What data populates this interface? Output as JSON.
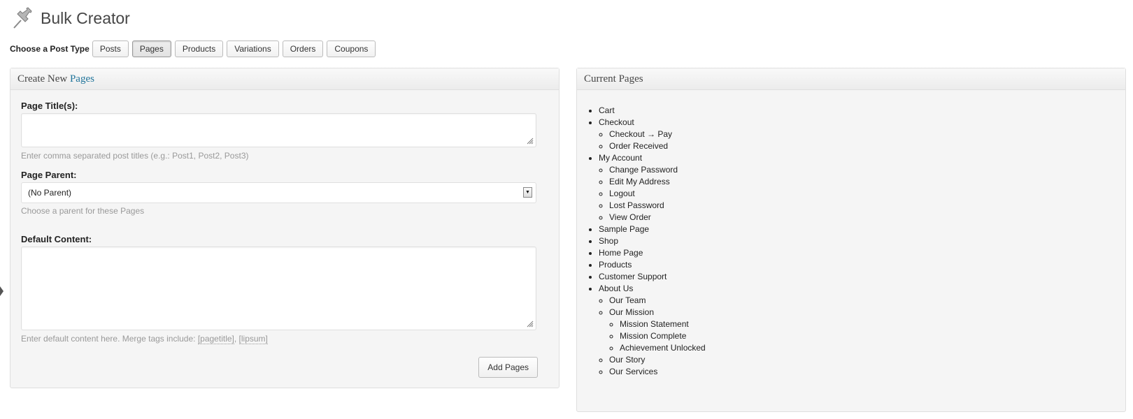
{
  "header": {
    "title": "Bulk Creator",
    "icon": "pushpin-icon"
  },
  "post_type": {
    "label": "Choose a Post Type",
    "options": [
      "Posts",
      "Pages",
      "Products",
      "Variations",
      "Orders",
      "Coupons"
    ],
    "selected": "Pages"
  },
  "create_panel": {
    "title_prefix": "Create New",
    "title_accent": "Pages",
    "page_title_label": "Page Title(s):",
    "page_title_value": "",
    "page_title_hint": "Enter comma separated post titles (e.g.: Post1, Post2, Post3)",
    "parent_label": "Page Parent:",
    "parent_value": "(No Parent)",
    "parent_hint": "Choose a parent for these Pages",
    "content_label": "Default Content:",
    "content_value": "",
    "content_hint_prefix": "Enter default content here. Merge tags include: ",
    "merge_tag_1": "[pagetitle]",
    "merge_tag_sep": ", ",
    "merge_tag_2": "[lipsum]",
    "submit_label": "Add Pages"
  },
  "current_panel": {
    "title": "Current Pages",
    "pages": [
      {
        "label": "Cart"
      },
      {
        "label": "Checkout",
        "children": [
          {
            "label": "Checkout → Pay"
          },
          {
            "label": "Order Received"
          }
        ]
      },
      {
        "label": "My Account",
        "children": [
          {
            "label": "Change Password"
          },
          {
            "label": "Edit My Address"
          },
          {
            "label": "Logout"
          },
          {
            "label": "Lost Password"
          },
          {
            "label": "View Order"
          }
        ]
      },
      {
        "label": "Sample Page"
      },
      {
        "label": "Shop"
      },
      {
        "label": "Home Page"
      },
      {
        "label": "Products"
      },
      {
        "label": "Customer Support"
      },
      {
        "label": "About Us",
        "children": [
          {
            "label": "Our Team"
          },
          {
            "label": "Our Mission",
            "children": [
              {
                "label": "Mission Statement"
              },
              {
                "label": "Mission Complete"
              },
              {
                "label": "Achievement Unlocked"
              }
            ]
          },
          {
            "label": "Our Story"
          },
          {
            "label": "Our Services"
          }
        ]
      }
    ]
  },
  "colors": {
    "accent": "#21759b",
    "hint": "#999999",
    "panel_bg": "#f5f5f5"
  }
}
